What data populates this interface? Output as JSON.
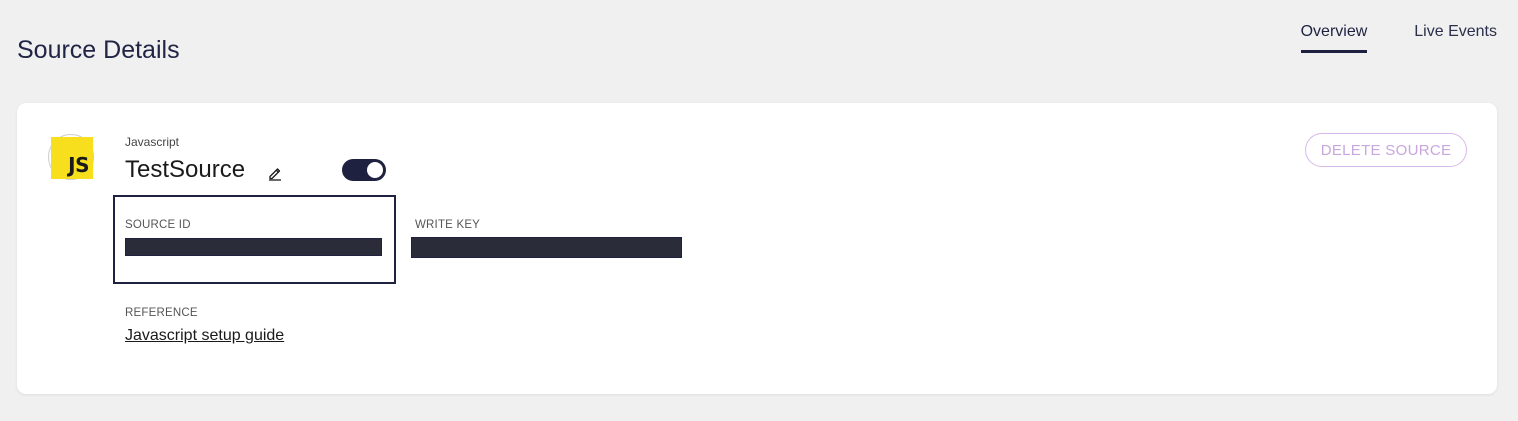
{
  "header": {
    "title": "Source Details",
    "tabs": [
      {
        "label": "Overview",
        "active": true
      },
      {
        "label": "Live Events",
        "active": false
      }
    ]
  },
  "source": {
    "logo_text": "JS",
    "type": "Javascript",
    "name": "TestSource",
    "enabled": true,
    "delete_label": "DELETE SOURCE",
    "source_id_label": "SOURCE ID",
    "write_key_label": "WRITE KEY",
    "reference_label": "REFERENCE",
    "reference_link": "Javascript setup guide"
  },
  "colors": {
    "accent": "#1e2240",
    "logo_bg": "#f7df1e",
    "delete_text": "#c9a6dd",
    "background": "#f0f0f0"
  },
  "icons": {
    "edit": "pencil-icon"
  }
}
